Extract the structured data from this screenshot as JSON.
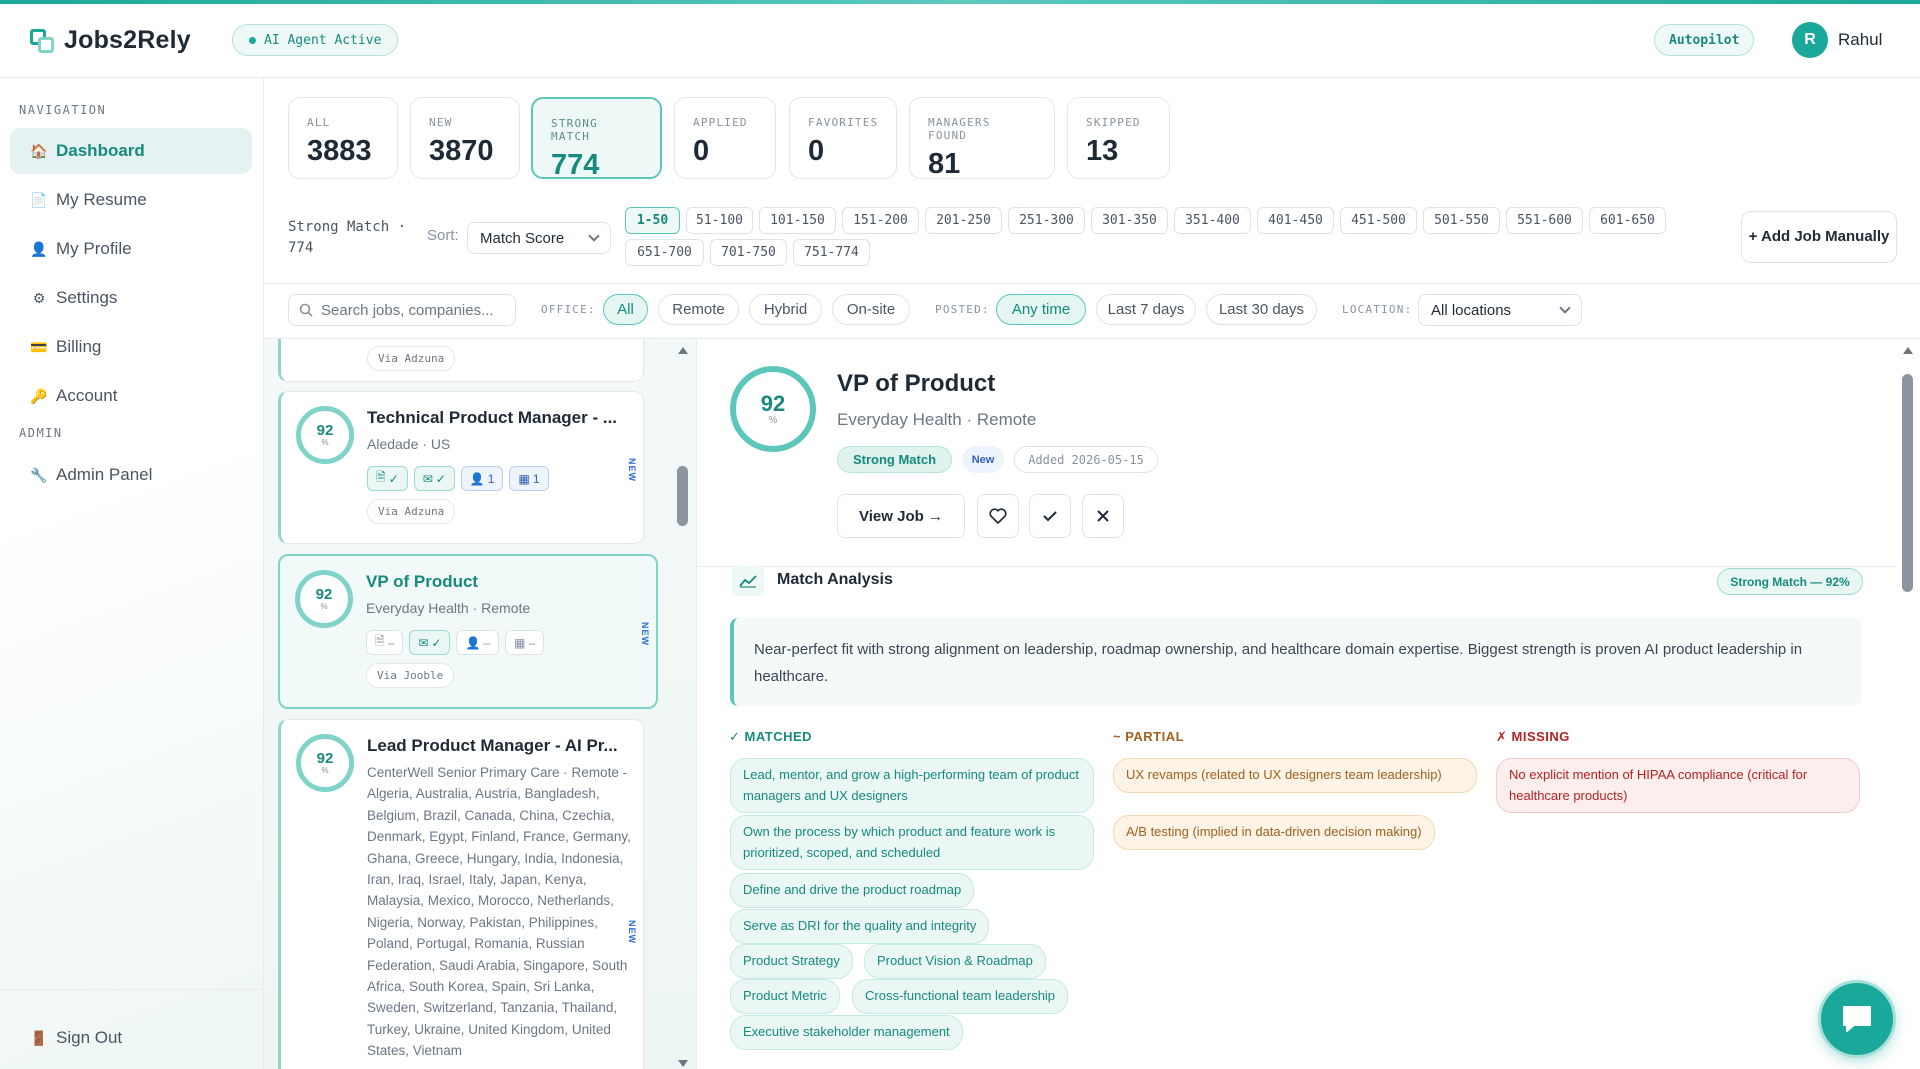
{
  "app": {
    "name": "Jobs2Rely",
    "agent_status": "AI Agent Active",
    "autopilot": "Autopilot"
  },
  "user": {
    "initial": "R",
    "name": "Rahul"
  },
  "colors": {
    "accent": "#1aa89a",
    "accent_light": "#eef9f7",
    "partial": "#a0621c",
    "missing": "#b42323",
    "new_tag": "#2f6fd0"
  },
  "sidebar": {
    "nav_heading": "NAVIGATION",
    "admin_heading": "ADMIN",
    "items": [
      {
        "label": "Dashboard",
        "icon": "house-icon",
        "glyph": "🏠"
      },
      {
        "label": "My Resume",
        "icon": "document-icon",
        "glyph": "📄"
      },
      {
        "label": "My Profile",
        "icon": "person-icon",
        "glyph": "👤"
      },
      {
        "label": "Settings",
        "icon": "gear-icon",
        "glyph": "⚙"
      },
      {
        "label": "Billing",
        "icon": "credit-card-icon",
        "glyph": "💳"
      },
      {
        "label": "Account",
        "icon": "key-icon",
        "glyph": "🔑"
      }
    ],
    "admin_item": {
      "label": "Admin Panel",
      "icon": "wrench-icon",
      "glyph": "🔧"
    },
    "sign_out": {
      "label": "Sign Out",
      "icon": "door-icon",
      "glyph": "🚪"
    }
  },
  "stats": [
    {
      "label": "ALL",
      "value": "3883"
    },
    {
      "label": "NEW",
      "value": "3870"
    },
    {
      "label": "STRONG MATCH",
      "value": "774"
    },
    {
      "label": "APPLIED",
      "value": "0"
    },
    {
      "label": "FAVORITES",
      "value": "0"
    },
    {
      "label": "MANAGERS FOUND",
      "value": "81"
    },
    {
      "label": "SKIPPED",
      "value": "13"
    }
  ],
  "filters": {
    "strong_line1": "Strong Match ·",
    "strong_line2": "774",
    "sort_label": "Sort:",
    "sort_value": "Match Score",
    "ranges": [
      "1-50",
      "51-100",
      "101-150",
      "151-200",
      "201-250",
      "251-300",
      "301-350",
      "351-400",
      "401-450",
      "451-500",
      "501-550",
      "551-600",
      "601-650",
      "651-700",
      "701-750",
      "751-774"
    ],
    "add_job": "+ Add Job Manually",
    "search_placeholder": "Search jobs, companies...",
    "office_label": "OFFICE:",
    "office": [
      "All",
      "Remote",
      "Hybrid",
      "On-site"
    ],
    "posted_label": "POSTED:",
    "posted": [
      "Any time",
      "Last 7 days",
      "Last 30 days"
    ],
    "location_label": "LOCATION:",
    "location_value": "All locations"
  },
  "jobs": [
    {
      "via": "Via Adzuna"
    },
    {
      "score": "92",
      "title": "Technical Product Manager - ...",
      "sub": "Aledade · US",
      "badges": [
        "✓",
        "✓",
        "1",
        "1"
      ],
      "via": "Via Adzuna",
      "new": "NEW"
    },
    {
      "score": "92",
      "title": "VP of Product",
      "sub": "Everyday Health · Remote",
      "badges": [
        "–",
        "✓",
        "–",
        "–"
      ],
      "via": "Via Jooble",
      "new": "NEW"
    },
    {
      "score": "92",
      "title": "Lead Product Manager - AI Pr...",
      "sub": "CenterWell Senior Primary Care · Remote - Algeria, Australia, Austria, Bangladesh, Belgium, Brazil, Canada, China, Czechia, Denmark, Egypt, Finland, France, Germany, Ghana, Greece, Hungary, India, Indonesia, Iran, Iraq, Israel, Italy, Japan, Kenya, Malaysia, Mexico, Morocco, Netherlands, Nigeria, Norway, Pakistan, Philippines, Poland, Portugal, Romania, Russian Federation, Saudi Arabia, Singapore, South Africa, South Korea, Spain, Sri Lanka, Sweden, Switzerland, Tanzania, Thailand, Turkey, Ukraine, United Kingdom, United States, Vietnam",
      "new": "NEW"
    }
  ],
  "pct_sign": "%",
  "detail": {
    "score": "92",
    "title": "VP of Product",
    "sub": "Everyday Health · Remote",
    "tag_strong": "Strong Match",
    "tag_new": "New",
    "added": "Added 2026-05-15",
    "view_job": "View Job →",
    "ma_title": "Match Analysis",
    "ma_score": "Strong Match — 92%",
    "summary": "Near-perfect fit with strong alignment on leadership, roadmap ownership, and healthcare domain expertise. Biggest strength is proven AI product leadership in healthcare.",
    "matched_head": "✓ MATCHED",
    "partial_head": "~ PARTIAL",
    "missing_head": "✗ MISSING",
    "matched": [
      "Lead, mentor, and grow a high-performing team of product managers and UX designers",
      "Own the process by which product and feature work is prioritized, scoped, and scheduled",
      "Define and drive the product roadmap",
      "Serve as DRI for the quality and integrity",
      "Product Strategy",
      "Product Vision & Roadmap",
      "Product Metric",
      "Cross-functional team leadership",
      "Executive stakeholder management"
    ],
    "partial": [
      "UX revamps (related to UX designers team leadership)",
      "A/B testing (implied in data-driven decision making)"
    ],
    "missing": [
      "No explicit mention of HIPAA compliance (critical for healthcare products)"
    ]
  }
}
